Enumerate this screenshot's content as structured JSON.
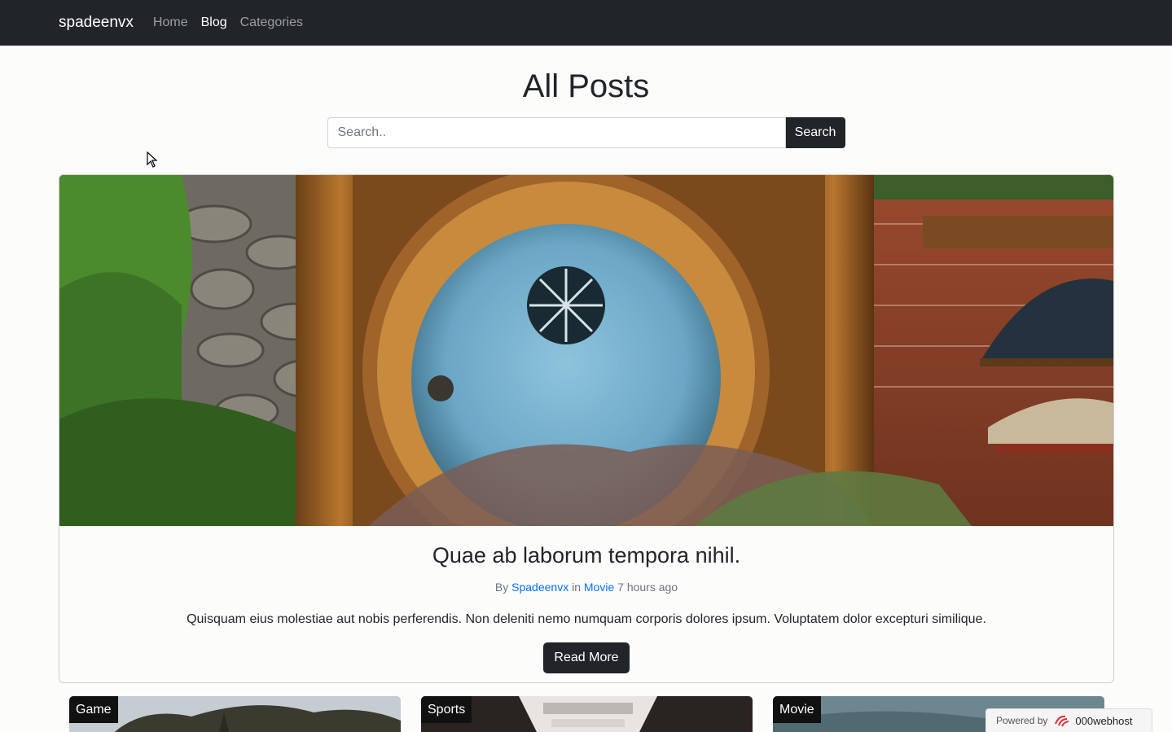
{
  "nav": {
    "brand": "spadeenvx",
    "links": [
      "Home",
      "Blog",
      "Categories"
    ]
  },
  "page": {
    "title": "All Posts"
  },
  "search": {
    "placeholder": "Search..",
    "button_label": "Search"
  },
  "featured": {
    "image_icon": "hobbit-door-image",
    "title": "Quae ab laborum tempora nihil.",
    "meta_by": "By",
    "author": "Spadeenvx",
    "meta_in": "in",
    "category": "Movie",
    "time": "7 hours ago",
    "excerpt": "Quisquam eius molestiae aut nobis perferendis. Non deleniti nemo numquam corporis dolores ipsum. Voluptatem dolor excepturi similique.",
    "read_more": "Read More"
  },
  "cards": [
    {
      "badge": "Game"
    },
    {
      "badge": "Sports"
    },
    {
      "badge": "Movie"
    }
  ],
  "footer_badge": {
    "prefix": "Powered by",
    "brand": "000webhost"
  },
  "colors": {
    "navbar": "#212529",
    "link": "#0d6efd",
    "button": "#212529"
  }
}
